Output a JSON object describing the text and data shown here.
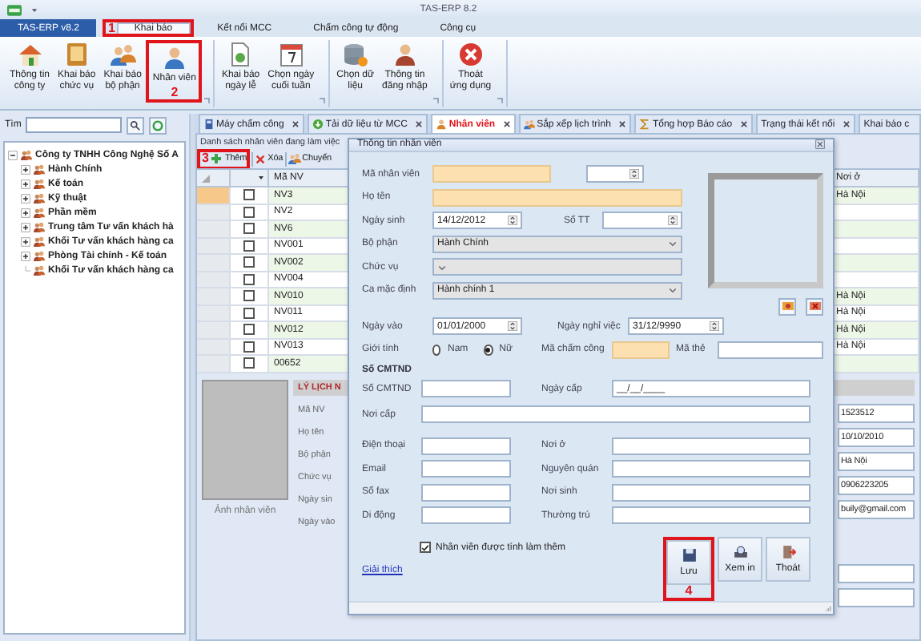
{
  "title_bar": {
    "title": "TAS-ERP 8.2"
  },
  "ribbon_tabs": [
    {
      "label": "TAS-ERP v8.2",
      "kind": "app",
      "selected": false
    },
    {
      "label": "Khai báo",
      "kind": "tab",
      "selected": true,
      "step": "1"
    },
    {
      "label": "Kết nối MCC",
      "kind": "tab",
      "selected": false
    },
    {
      "label": "Chấm công tự động",
      "kind": "tab",
      "selected": false
    },
    {
      "label": "Công cụ",
      "kind": "tab",
      "selected": false
    }
  ],
  "ribbon_groups": [
    {
      "buttons": [
        {
          "label": "Thông tin\ncông ty"
        },
        {
          "label": "Khai báo\nchức vụ"
        },
        {
          "label": "Khai báo\nbộ phận"
        },
        {
          "label": "Nhân viên",
          "step": "2"
        }
      ]
    },
    {
      "buttons": [
        {
          "label": "Khai báo\nngày lễ"
        },
        {
          "label": "Chọn ngày\ncuối tuần"
        }
      ]
    },
    {
      "buttons": [
        {
          "label": "Chọn dữ\nliệu"
        },
        {
          "label": "Thông tin\nđăng nhập"
        }
      ]
    },
    {
      "buttons": [
        {
          "label": "Thoát\nứng dụng"
        }
      ]
    }
  ],
  "search": {
    "label": "Tìm"
  },
  "tree": {
    "label": "Công ty TNHH Công Nghệ Số A",
    "expanded": true,
    "children": [
      {
        "label": "Hành Chính",
        "expanded": false
      },
      {
        "label": "Kế toán",
        "expanded": false
      },
      {
        "label": "Kỹ thuật",
        "expanded": false
      },
      {
        "label": "Phần mềm",
        "expanded": false
      },
      {
        "label": "Trung tâm Tư vấn khách hà",
        "expanded": false
      },
      {
        "label": "Khối Tư vấn khách hàng ca",
        "expanded": false
      },
      {
        "label": "Phòng Tài chính - Kế toán",
        "expanded": false
      },
      {
        "label": "Khối Tư vấn khách hàng ca"
      }
    ]
  },
  "main_tabs": [
    {
      "label": "Máy chấm công",
      "selected": false
    },
    {
      "label": "Tải dữ liệu từ MCC",
      "selected": false
    },
    {
      "label": "Nhân viên",
      "selected": true
    },
    {
      "label": "Sắp xếp lịch trình",
      "selected": false
    },
    {
      "label": "Tổng hợp Báo cáo",
      "selected": false
    },
    {
      "label": "Trạng thái kết nối",
      "selected": false
    },
    {
      "label": "Khai báo c",
      "selected": false
    }
  ],
  "employee_list": {
    "title": "Danh sách nhân viên đang làm việc",
    "toolbar": [
      {
        "label": "Thêm",
        "step": "3"
      },
      {
        "label": "Xóa"
      },
      {
        "label": "Chuyển"
      }
    ],
    "columns": {
      "code": "Mã NV",
      "residence": "Nơi ở"
    },
    "rows": [
      {
        "code": "NV3",
        "checked": false,
        "selected": true,
        "residence": "Hà Nội"
      },
      {
        "code": "NV2",
        "checked": false,
        "selected": false
      },
      {
        "code": "NV6",
        "checked": false,
        "selected": false
      },
      {
        "code": "NV001",
        "checked": false,
        "selected": false
      },
      {
        "code": "NV002",
        "checked": false,
        "selected": false
      },
      {
        "code": "NV004",
        "checked": false,
        "selected": false
      },
      {
        "code": "NV010",
        "checked": false,
        "selected": false,
        "residence": "Hà Nội"
      },
      {
        "code": "NV011",
        "checked": false,
        "selected": false,
        "residence": "Hà Nội"
      },
      {
        "code": "NV012",
        "checked": false,
        "selected": false,
        "residence": "Hà Nội"
      },
      {
        "code": "NV013",
        "checked": false,
        "selected": false,
        "residence": "Hà Nội"
      },
      {
        "code": "00652",
        "checked": false,
        "selected": false
      }
    ]
  },
  "detail": {
    "photo_caption": "Ảnh nhân viên",
    "header": "LÝ LỊCH N",
    "labels": [
      "Mã NV",
      "Họ tên",
      "Bộ phận",
      "Chức vụ",
      "Ngày sin",
      "Ngày vào"
    ],
    "values": [
      "1523512",
      "10/10/2010",
      "Hà Nội",
      "0906223205",
      "buily@gmail.com"
    ]
  },
  "dialog": {
    "title": "Thông tin nhân viên",
    "code": {
      "label": "Mã nhân viên",
      "required": true
    },
    "full_name": {
      "label": "Họ tên",
      "required": true
    },
    "birth_date": {
      "label": "Ngày sinh",
      "value": "14/12/2012"
    },
    "order_no": {
      "label": "Số TT"
    },
    "department": {
      "label": "Bộ phận",
      "value": "Hành Chính"
    },
    "position": {
      "label": "Chức vụ"
    },
    "default_shift": {
      "label": "Ca mặc định",
      "value": "Hành chính 1"
    },
    "start_date": {
      "label": "Ngày vào",
      "value": "01/01/2000"
    },
    "end_date": {
      "label": "Ngày nghỉ việc",
      "value": "31/12/9990"
    },
    "gender": {
      "label": "Giới tính",
      "options": [
        {
          "label": "Nam",
          "selected": false
        },
        {
          "label": "Nữ",
          "selected": true
        }
      ]
    },
    "attendance_code": {
      "label": "Mã chấm công",
      "required": true
    },
    "card_code": {
      "label": "Mã thẻ"
    },
    "id_section": "Số CMTND",
    "id_row": {
      "left": {
        "label": "Số CMTND"
      },
      "right": {
        "label": "Ngày cấp",
        "value": "__/__/____"
      }
    },
    "issue_place": {
      "label": "Nơi cấp"
    },
    "contact_rows": [
      {
        "left": {
          "label": "Điện thoại"
        },
        "right": {
          "label": "Nơi ở"
        }
      },
      {
        "left": {
          "label": "Email"
        },
        "right": {
          "label": "Nguyên quán"
        }
      },
      {
        "left": {
          "label": "Số fax"
        },
        "right": {
          "label": "Nơi sinh"
        }
      },
      {
        "left": {
          "label": "Di động"
        },
        "right": {
          "label": "Thường trú"
        }
      }
    ],
    "overtime": {
      "label": "Nhân viên được tính làm thêm",
      "checked": true
    },
    "help_link": "Giải thích",
    "buttons": [
      {
        "label": "Lưu",
        "step": "4"
      },
      {
        "label": "Xem in"
      },
      {
        "label": "Thoát"
      }
    ]
  }
}
